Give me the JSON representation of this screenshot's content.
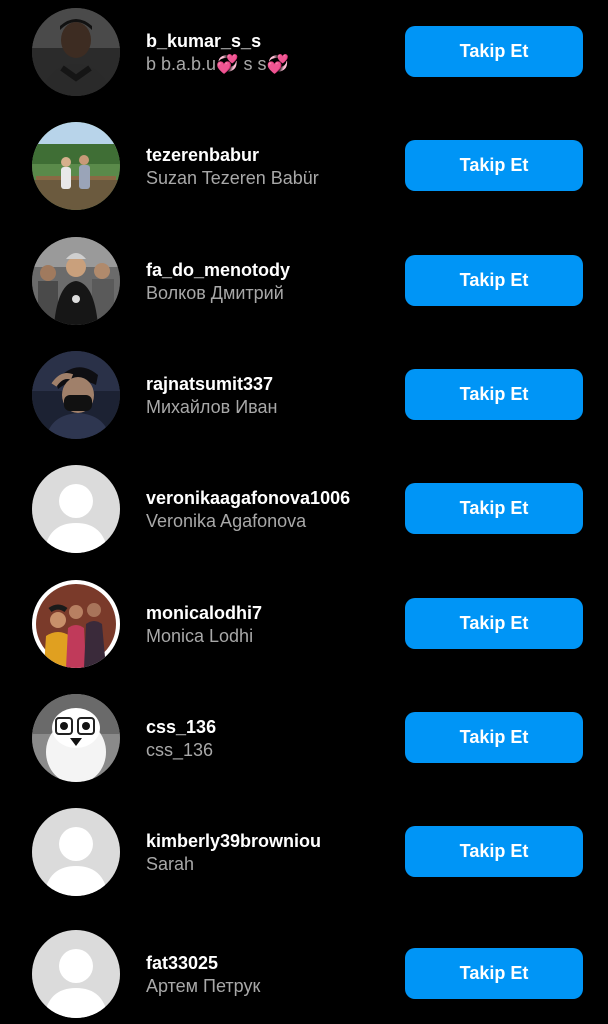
{
  "follow_label": "Takip Et",
  "users": [
    {
      "username": "b_kumar_s_s",
      "full_name": "b b.a.b.u💞 s s💞",
      "avatar": "photo-man-dark"
    },
    {
      "username": "tezerenbabur",
      "full_name": "Suzan Tezeren Babür",
      "avatar": "photo-couple-outdoors"
    },
    {
      "username": "fa_do_menotody",
      "full_name": "Волков Дмитрий",
      "avatar": "photo-group-men"
    },
    {
      "username": "rajnatsumit337",
      "full_name": "Михайлов Иван",
      "avatar": "photo-man-mask"
    },
    {
      "username": "veronikaagafonova1006",
      "full_name": "Veronika Agafonova",
      "avatar": "default-avatar"
    },
    {
      "username": "monicalodhi7",
      "full_name": "Monica Lodhi",
      "avatar": "photo-group-women"
    },
    {
      "username": "css_136",
      "full_name": "css_136",
      "avatar": "photo-cartoon-bird"
    },
    {
      "username": "kimberly39browniou",
      "full_name": "Sarah",
      "avatar": "default-avatar"
    },
    {
      "username": "fat33025",
      "full_name": "Артем Петрук",
      "avatar": "default-avatar"
    }
  ],
  "colors": {
    "background": "#000000",
    "button": "#0095f6",
    "username": "#ffffff",
    "fullname": "#a8a8a8"
  }
}
